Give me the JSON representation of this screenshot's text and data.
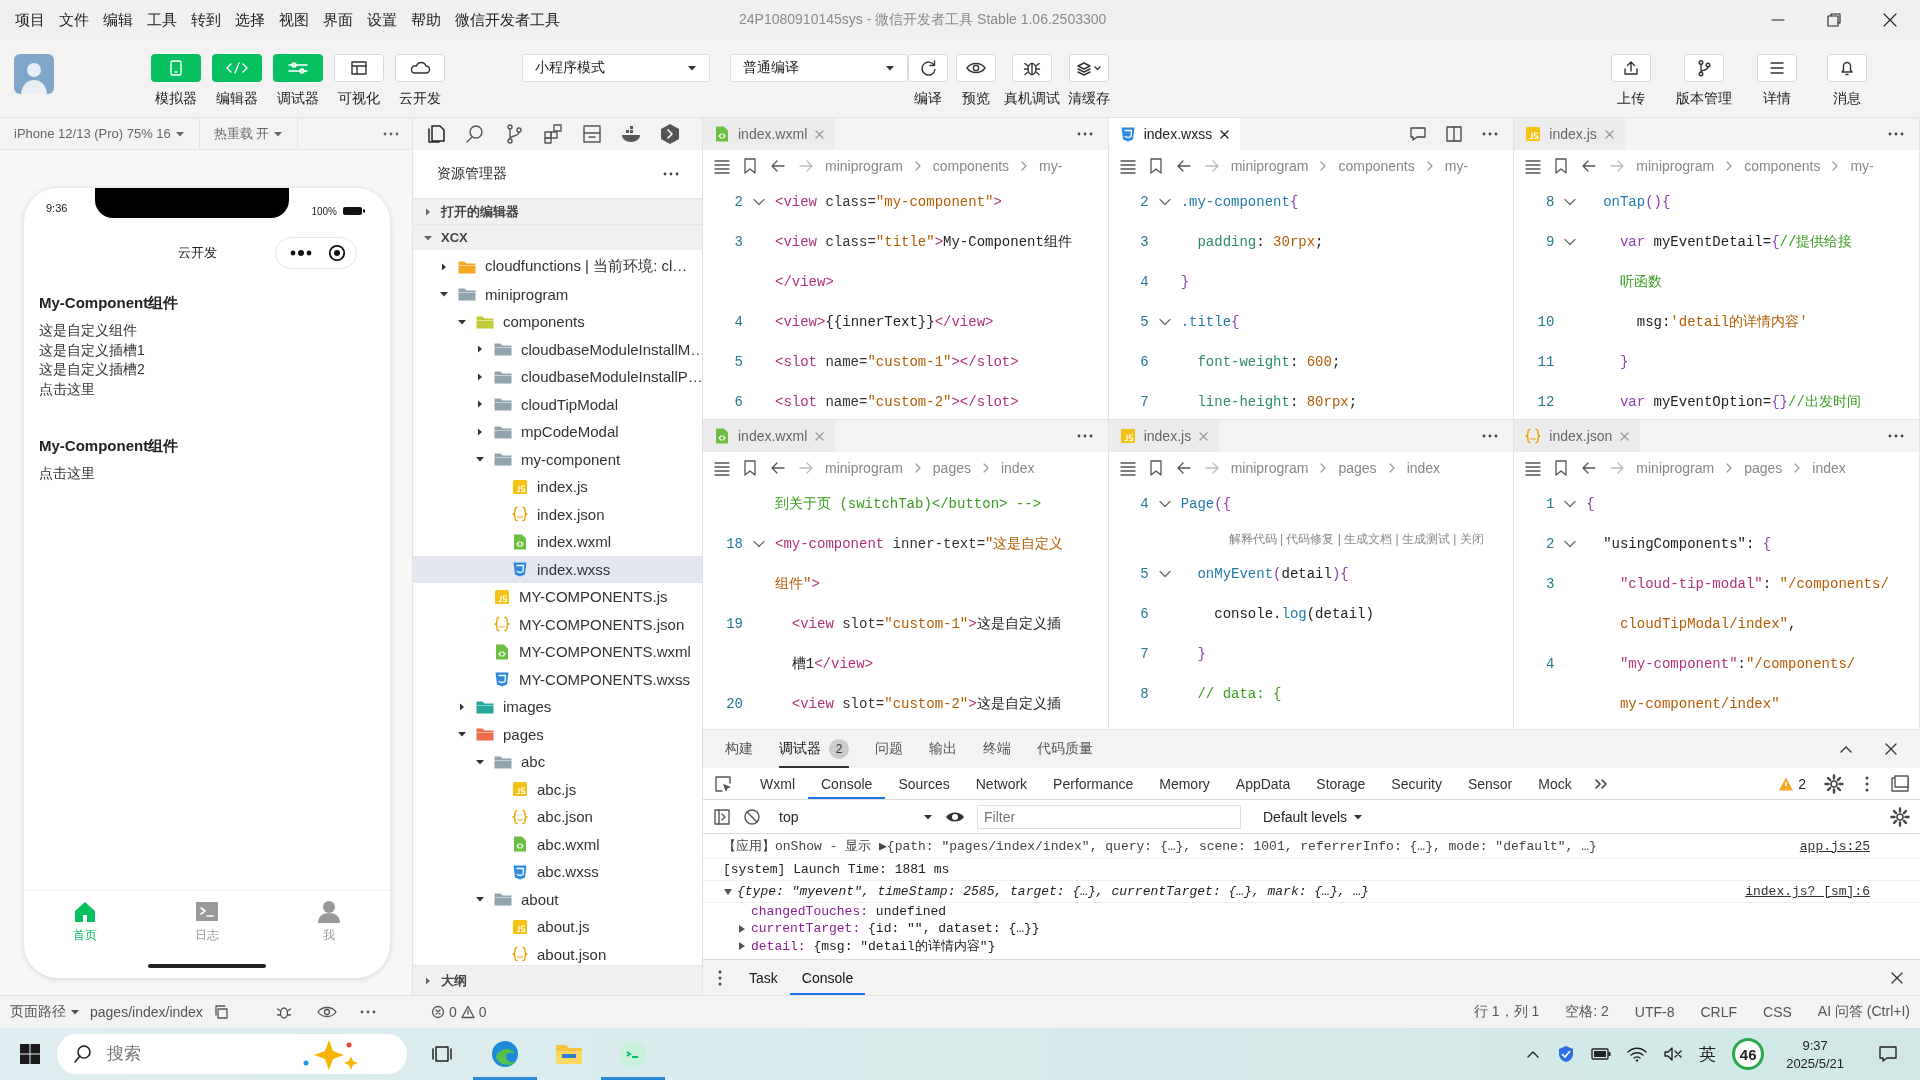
{
  "menu": [
    "项目",
    "文件",
    "编辑",
    "工具",
    "转到",
    "选择",
    "视图",
    "界面",
    "设置",
    "帮助",
    "微信开发者工具"
  ],
  "window": {
    "title": "24P1080910145sys - 微信开发者工具 Stable 1.06.2503300"
  },
  "toolbar": {
    "view_buttons": [
      {
        "label": "模拟器",
        "kind": "phone",
        "selected": true
      },
      {
        "label": "编辑器",
        "kind": "code",
        "selected": true
      },
      {
        "label": "调试器",
        "kind": "sliders",
        "selected": true
      },
      {
        "label": "可视化",
        "kind": "layout",
        "selected": false
      },
      {
        "label": "云开发",
        "kind": "cloud",
        "selected": false
      }
    ],
    "mode": "小程序模式",
    "compile_mode": "普通编译",
    "actions": [
      {
        "label": "编译",
        "kind": "refresh"
      },
      {
        "label": "预览",
        "kind": "eye"
      },
      {
        "label": "真机调试",
        "kind": "bug"
      },
      {
        "label": "清缓存",
        "kind": "layers"
      }
    ],
    "right_actions": [
      {
        "label": "上传",
        "kind": "upload"
      },
      {
        "label": "版本管理",
        "kind": "branch"
      },
      {
        "label": "详情",
        "kind": "menu"
      },
      {
        "label": "消息",
        "kind": "bell"
      }
    ]
  },
  "simulator": {
    "device": "iPhone 12/13 (Pro) 75% 16",
    "hot_reload": "热重载 开",
    "phone": {
      "time": "9:36",
      "battery": "100%",
      "nav_title": "云开发",
      "blocks": [
        {
          "title": "My-Component组件",
          "lines": [
            "这是自定义组件",
            "这是自定义插槽1",
            "这是自定义插槽2",
            "点击这里"
          ]
        },
        {
          "title": "My-Component组件",
          "lines": [
            "点击这里"
          ]
        }
      ],
      "tabbar": [
        {
          "label": "首页",
          "kind": "home",
          "selected": true
        },
        {
          "label": "日志",
          "kind": "terminal",
          "selected": false
        },
        {
          "label": "我",
          "kind": "person",
          "selected": false
        }
      ]
    }
  },
  "explorer": {
    "title": "资源管理器",
    "sections": [
      {
        "label": "打开的编辑器",
        "expanded": false
      },
      {
        "label": "XCX",
        "expanded": true
      }
    ],
    "tree": [
      {
        "name": "cloudfunctions | 当前环境: cl…",
        "kind": "cloud-folder",
        "expanded": false,
        "selected": false
      },
      {
        "name": "miniprogram",
        "kind": "folder",
        "expanded": true,
        "selected": false,
        "children": [
          {
            "name": "components",
            "kind": "components-folder",
            "expanded": true,
            "selected": false,
            "children": [
              {
                "name": "cloudbaseModuleInstallM…",
                "kind": "folder",
                "expanded": false,
                "selected": false
              },
              {
                "name": "cloudbaseModuleInstallP…",
                "kind": "folder",
                "expanded": false,
                "selected": false
              },
              {
                "name": "cloudTipModal",
                "kind": "folder",
                "expanded": false,
                "selected": false
              },
              {
                "name": "mpCodeModal",
                "kind": "folder",
                "expanded": false,
                "selected": false
              },
              {
                "name": "my-component",
                "kind": "folder",
                "expanded": true,
                "selected": false,
                "children": [
                  {
                    "name": "index.js",
                    "kind": "js",
                    "selected": false
                  },
                  {
                    "name": "index.json",
                    "kind": "json",
                    "selected": false
                  },
                  {
                    "name": "index.wxml",
                    "kind": "wxml",
                    "selected": false
                  },
                  {
                    "name": "index.wxss",
                    "kind": "wxss",
                    "selected": true
                  }
                ]
              },
              {
                "name": "MY-COMPONENTS.js",
                "kind": "js",
                "selected": false
              },
              {
                "name": "MY-COMPONENTS.json",
                "kind": "json",
                "selected": false
              },
              {
                "name": "MY-COMPONENTS.wxml",
                "kind": "wxml",
                "selected": false
              },
              {
                "name": "MY-COMPONENTS.wxss",
                "kind": "wxss",
                "selected": false
              }
            ]
          },
          {
            "name": "images",
            "kind": "images-folder",
            "expanded": false,
            "selected": false
          },
          {
            "name": "pages",
            "kind": "pages-folder",
            "expanded": true,
            "selected": false,
            "children": [
              {
                "name": "abc",
                "kind": "folder",
                "expanded": true,
                "selected": false,
                "children": [
                  {
                    "name": "abc.js",
                    "kind": "js",
                    "selected": false
                  },
                  {
                    "name": "abc.json",
                    "kind": "json",
                    "selected": false
                  },
                  {
                    "name": "abc.wxml",
                    "kind": "wxml",
                    "selected": false
                  },
                  {
                    "name": "abc.wxss",
                    "kind": "wxss",
                    "selected": false
                  }
                ]
              },
              {
                "name": "about",
                "kind": "folder",
                "expanded": true,
                "selected": false,
                "children": [
                  {
                    "name": "about.js",
                    "kind": "js",
                    "selected": false
                  },
                  {
                    "name": "about.json",
                    "kind": "json",
                    "selected": false
                  }
                ]
              }
            ]
          }
        ]
      }
    ],
    "outline": {
      "label": "大纲",
      "expanded": false
    }
  },
  "editors": [
    {
      "tab": {
        "name": "index.wxml",
        "kind": "wxml",
        "selected": false
      },
      "breadcrumb": [
        "miniprogram",
        "components",
        "my-"
      ],
      "lines": [
        {
          "num": "2",
          "fold": true,
          "kind": "code",
          "segs": [
            {
              "kind": "tag",
              "text": "<view"
            },
            {
              "kind": "attr",
              "text": " class="
            },
            {
              "kind": "str",
              "text": "\"my-component\""
            },
            {
              "kind": "tag",
              "text": ">"
            }
          ]
        },
        {
          "num": "3",
          "kind": "code",
          "segs": [
            {
              "kind": "tag",
              "text": "<view"
            },
            {
              "kind": "attr",
              "text": " class="
            },
            {
              "kind": "str",
              "text": "\"title\""
            },
            {
              "kind": "tag",
              "text": ">"
            },
            {
              "kind": "txt",
              "text": "My-Component组件"
            }
          ]
        },
        {
          "kind": "code",
          "segs": [
            {
              "kind": "tag",
              "text": "</view>"
            }
          ]
        },
        {
          "num": "4",
          "kind": "code",
          "segs": [
            {
              "kind": "tag",
              "text": "<view>"
            },
            {
              "kind": "txt",
              "text": "{{innerText}}"
            },
            {
              "kind": "tag",
              "text": "</view>"
            }
          ]
        },
        {
          "num": "5",
          "kind": "code",
          "segs": [
            {
              "kind": "tag",
              "text": "<slot"
            },
            {
              "kind": "attr",
              "text": " name="
            },
            {
              "kind": "str",
              "text": "\"custom-1\""
            },
            {
              "kind": "tag",
              "text": "></slot>"
            }
          ]
        },
        {
          "num": "6",
          "kind": "code",
          "segs": [
            {
              "kind": "tag",
              "text": "<slot"
            },
            {
              "kind": "attr",
              "text": " name="
            },
            {
              "kind": "str",
              "text": "\"custom-2\""
            },
            {
              "kind": "tag",
              "text": "></slot>"
            }
          ]
        }
      ]
    },
    {
      "tab": {
        "name": "index.wxss",
        "kind": "wxss",
        "selected": true
      },
      "tools": [
        {
          "kind": "comment"
        },
        {
          "kind": "split"
        }
      ],
      "breadcrumb": [
        "miniprogram",
        "components",
        "my-"
      ],
      "lines": [
        {
          "num": "2",
          "fold": true,
          "kind": "code",
          "segs": [
            {
              "kind": "sel",
              "text": ".my-component"
            },
            {
              "kind": "pun",
              "text": "{"
            }
          ]
        },
        {
          "num": "3",
          "kind": "code",
          "segs": [
            {
              "kind": "prop",
              "text": "  padding"
            },
            {
              "kind": "txt",
              "text": ": "
            },
            {
              "kind": "num",
              "text": "30rpx"
            },
            {
              "kind": "txt",
              "text": ";"
            }
          ]
        },
        {
          "num": "4",
          "kind": "code",
          "segs": [
            {
              "kind": "pun",
              "text": "}"
            }
          ]
        },
        {
          "num": "5",
          "fold": true,
          "kind": "code",
          "segs": [
            {
              "kind": "sel",
              "text": ".title"
            },
            {
              "kind": "pun",
              "text": "{"
            }
          ]
        },
        {
          "num": "6",
          "kind": "code",
          "segs": [
            {
              "kind": "prop",
              "text": "  font-weight"
            },
            {
              "kind": "txt",
              "text": ": "
            },
            {
              "kind": "num",
              "text": "600"
            },
            {
              "kind": "txt",
              "text": ";"
            }
          ]
        },
        {
          "num": "7",
          "kind": "code",
          "segs": [
            {
              "kind": "prop",
              "text": "  line-height"
            },
            {
              "kind": "txt",
              "text": ": "
            },
            {
              "kind": "num",
              "text": "80rpx"
            },
            {
              "kind": "txt",
              "text": ";"
            }
          ]
        }
      ]
    },
    {
      "tab": {
        "name": "index.js",
        "kind": "js",
        "selected": false
      },
      "breadcrumb": [
        "miniprogram",
        "components",
        "my-"
      ],
      "lines": [
        {
          "num": "8",
          "fold": true,
          "kind": "code",
          "segs": [
            {
              "kind": "fn",
              "text": "  onTap"
            },
            {
              "kind": "pun",
              "text": "(){"
            }
          ]
        },
        {
          "num": "9",
          "fold": true,
          "kind": "code",
          "segs": [
            {
              "kind": "kw",
              "text": "    var"
            },
            {
              "kind": "txt",
              "text": " myEventDetail="
            },
            {
              "kind": "pun",
              "text": "{"
            },
            {
              "kind": "cm",
              "text": "//提供给接"
            }
          ]
        },
        {
          "kind": "code",
          "segs": [
            {
              "kind": "cm",
              "text": "    听函数"
            }
          ]
        },
        {
          "num": "10",
          "kind": "code",
          "segs": [
            {
              "kind": "txt",
              "text": "      msg:"
            },
            {
              "kind": "str",
              "text": "'detail的详情内容'"
            }
          ]
        },
        {
          "num": "11",
          "kind": "code",
          "segs": [
            {
              "kind": "pun",
              "text": "    }"
            }
          ]
        },
        {
          "num": "12",
          "kind": "code",
          "segs": [
            {
              "kind": "kw",
              "text": "    var"
            },
            {
              "kind": "txt",
              "text": " myEventOption="
            },
            {
              "kind": "pun",
              "text": "{}"
            },
            {
              "kind": "cm",
              "text": "//出发时间"
            }
          ]
        }
      ]
    },
    {
      "tab": {
        "name": "index.wxml",
        "kind": "wxml",
        "selected": false
      },
      "breadcrumb": [
        "miniprogram",
        "pages",
        "index"
      ],
      "lines": [
        {
          "kind": "code",
          "segs": [
            {
              "kind": "cm",
              "text": "到关于页 (switchTab)</button> -->"
            }
          ]
        },
        {
          "num": "18",
          "fold": true,
          "kind": "code",
          "segs": [
            {
              "kind": "tag",
              "text": "<my-component"
            },
            {
              "kind": "attr",
              "text": " inner-text="
            },
            {
              "kind": "str",
              "text": "\"这是自定义"
            }
          ]
        },
        {
          "kind": "code",
          "segs": [
            {
              "kind": "str",
              "text": "组件\""
            },
            {
              "kind": "tag",
              "text": ">"
            }
          ]
        },
        {
          "num": "19",
          "kind": "code",
          "segs": [
            {
              "kind": "tag",
              "text": "  <view"
            },
            {
              "kind": "attr",
              "text": " slot="
            },
            {
              "kind": "str",
              "text": "\"custom-1\""
            },
            {
              "kind": "tag",
              "text": ">"
            },
            {
              "kind": "txt",
              "text": "这是自定义插"
            }
          ]
        },
        {
          "kind": "code",
          "segs": [
            {
              "kind": "txt",
              "text": "  槽1"
            },
            {
              "kind": "tag",
              "text": "</view>"
            }
          ]
        },
        {
          "num": "20",
          "kind": "code",
          "segs": [
            {
              "kind": "tag",
              "text": "  <view"
            },
            {
              "kind": "attr",
              "text": " slot="
            },
            {
              "kind": "str",
              "text": "\"custom-2\""
            },
            {
              "kind": "tag",
              "text": ">"
            },
            {
              "kind": "txt",
              "text": "这是自定义插"
            }
          ]
        }
      ]
    },
    {
      "tab": {
        "name": "index.js",
        "kind": "js",
        "selected": false
      },
      "breadcrumb": [
        "miniprogram",
        "pages",
        "index"
      ],
      "lines": [
        {
          "num": "4",
          "fold": true,
          "kind": "code",
          "segs": [
            {
              "kind": "fn",
              "text": "Page"
            },
            {
              "kind": "pun",
              "text": "({"
            }
          ]
        },
        {
          "kind": "codelens",
          "text": "解释代码 | 代码修复 | 生成文档 | 生成测试 | 关闭"
        },
        {
          "num": "5",
          "fold": true,
          "kind": "code",
          "segs": [
            {
              "kind": "fn",
              "text": "  onMyEvent"
            },
            {
              "kind": "pun",
              "text": "("
            },
            {
              "kind": "txt",
              "text": "detail"
            },
            {
              "kind": "pun",
              "text": "){"
            }
          ]
        },
        {
          "num": "6",
          "kind": "code",
          "segs": [
            {
              "kind": "txt",
              "text": "    console."
            },
            {
              "kind": "fn",
              "text": "log"
            },
            {
              "kind": "txt",
              "text": "(detail)"
            }
          ]
        },
        {
          "num": "7",
          "kind": "code",
          "segs": [
            {
              "kind": "pun",
              "text": "  }"
            }
          ]
        },
        {
          "num": "8",
          "kind": "code",
          "segs": [
            {
              "kind": "cm",
              "text": "  // data: {"
            }
          ]
        }
      ]
    },
    {
      "tab": {
        "name": "index.json",
        "kind": "json",
        "selected": false
      },
      "breadcrumb": [
        "miniprogram",
        "pages",
        "index"
      ],
      "lines": [
        {
          "num": "1",
          "fold": true,
          "kind": "code",
          "segs": [
            {
              "kind": "pun",
              "text": "{"
            }
          ]
        },
        {
          "num": "2",
          "fold": true,
          "kind": "code",
          "segs": [
            {
              "kind": "txt",
              "text": "  \"usingComponents\": "
            },
            {
              "kind": "pun",
              "text": "{"
            }
          ]
        },
        {
          "num": "3",
          "kind": "code",
          "segs": [
            {
              "kind": "key",
              "text": "    \"cloud-tip-modal\""
            },
            {
              "kind": "txt",
              "text": ": "
            },
            {
              "kind": "str",
              "text": "\"/components/"
            }
          ]
        },
        {
          "kind": "code",
          "segs": [
            {
              "kind": "str",
              "text": "    cloudTipModal/index\""
            },
            {
              "kind": "txt",
              "text": ","
            }
          ]
        },
        {
          "num": "4",
          "kind": "code",
          "segs": [
            {
              "kind": "key",
              "text": "    \"my-component\""
            },
            {
              "kind": "txt",
              "text": ":"
            },
            {
              "kind": "str",
              "text": "\"/components/"
            }
          ]
        },
        {
          "kind": "code",
          "segs": [
            {
              "kind": "str",
              "text": "    my-component/index\""
            }
          ]
        }
      ]
    }
  ],
  "devtools": {
    "panel_tabs": [
      {
        "label": "构建",
        "selected": false
      },
      {
        "label": "调试器",
        "selected": true,
        "badge": "2"
      },
      {
        "label": "问题",
        "selected": false
      },
      {
        "label": "输出",
        "selected": false
      },
      {
        "label": "终端",
        "selected": false
      },
      {
        "label": "代码质量",
        "selected": false
      }
    ],
    "tabs": [
      {
        "label": "Wxml",
        "selected": false
      },
      {
        "label": "Console",
        "selected": true
      },
      {
        "label": "Sources",
        "selected": false
      },
      {
        "label": "Network",
        "selected": false
      },
      {
        "label": "Performance",
        "selected": false
      },
      {
        "label": "Memory",
        "selected": false
      },
      {
        "label": "AppData",
        "selected": false
      },
      {
        "label": "Storage",
        "selected": false
      },
      {
        "label": "Security",
        "selected": false
      },
      {
        "label": "Sensor",
        "selected": false
      },
      {
        "label": "Mock",
        "selected": false
      }
    ],
    "warnings": "2",
    "context": "top",
    "filter_placeholder": "Filter",
    "levels": "Default levels",
    "messages": [
      {
        "kind": "log",
        "text": "【应用】onShow - 显示 ▶{path: \"pages/index/index\", query: {…}, scene: 1001, referrerInfo: {…}, mode: \"default\", …}",
        "source": "app.js:25"
      },
      {
        "kind": "system",
        "text": "[system] Launch Time: 1881 ms"
      },
      {
        "kind": "object",
        "text": "{type: \"myevent\", timeStamp: 2585, target: {…}, currentTarget: {…}, mark: {…}, …}",
        "source": "index.js? [sm]:6",
        "expanded": true,
        "children": [
          {
            "key": "changedTouches:",
            "value": "undefined",
            "expandable": false
          },
          {
            "key": "currentTarget:",
            "value": "{id: \"\", dataset: {…}}",
            "expandable": true
          },
          {
            "key": "detail:",
            "value": "{msg: \"detail的详情内容\"}",
            "expandable": true
          }
        ]
      }
    ],
    "drawer_tabs": [
      {
        "label": "Task",
        "selected": false
      },
      {
        "label": "Console",
        "selected": true
      }
    ]
  },
  "status_bar": {
    "path_label": "页面路径",
    "page_path": "pages/index/index",
    "errors": "0",
    "warnings": "0",
    "items": [
      "行 1，列 1",
      "空格: 2",
      "UTF-8",
      "CRLF",
      "CSS",
      "AI 问答 (Ctrl+I)"
    ]
  },
  "taskbar": {
    "search_placeholder": "搜索",
    "apps": [
      {
        "kind": "edge",
        "running": true
      },
      {
        "kind": "folder",
        "running": false
      },
      {
        "kind": "devtools",
        "running": true
      }
    ],
    "ime": "英",
    "badge": "46",
    "time": "9:37",
    "date": "2025/5/21"
  }
}
